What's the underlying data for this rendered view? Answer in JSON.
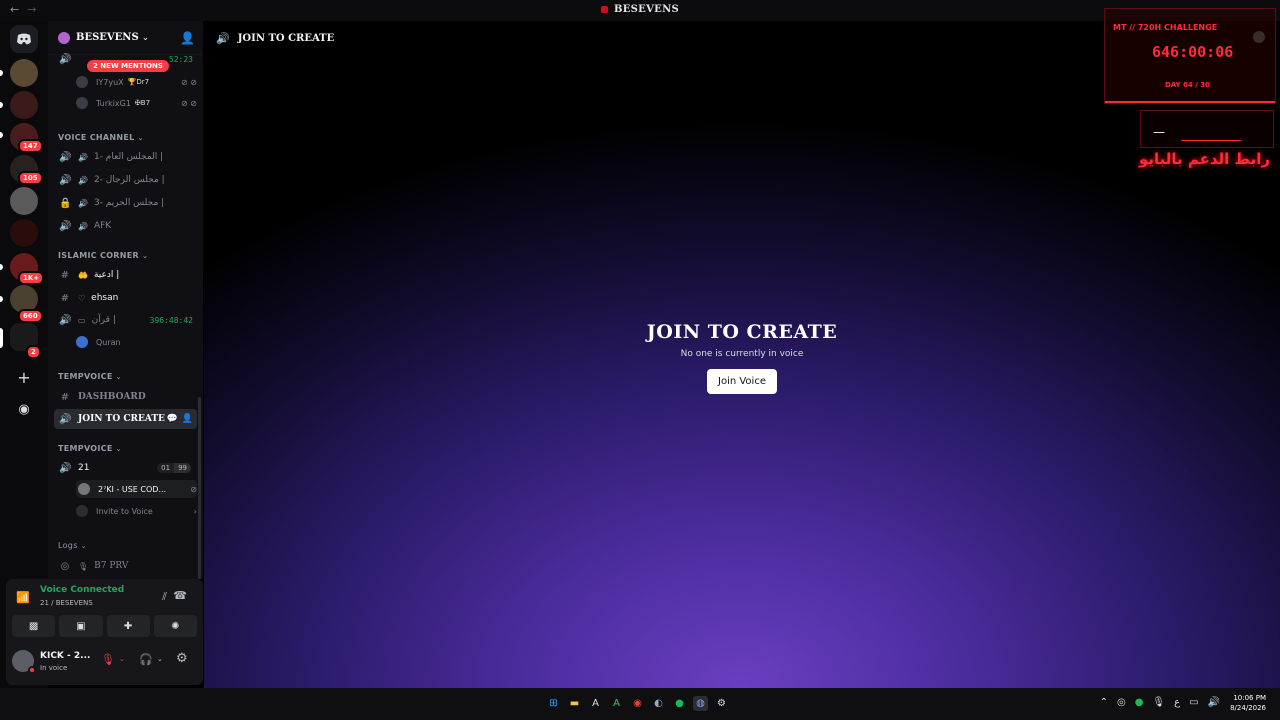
{
  "window": {
    "title": "BESEVENS"
  },
  "server": {
    "name": "BESEVENS"
  },
  "rail_badges": [
    "147",
    "105",
    "1K+",
    "660",
    "2"
  ],
  "mentions": "2 NEW MENTIONS",
  "top_users": [
    {
      "name": "IY7yuX",
      "tag": "🏆Dr7"
    },
    {
      "name": "TurkixG1",
      "tag": "✠B7"
    }
  ],
  "top_timer": "52:23",
  "categories": {
    "voice": "VOICE CHANNEL",
    "islamic": "ISLAMIC CORNER",
    "temp1": "TEMPVOICE",
    "temp2": "TEMPVOICE",
    "logs": "Logs"
  },
  "voice_channels": [
    {
      "name": "المجلس العام -1 |"
    },
    {
      "name": "مجلس الرجال -2 |"
    },
    {
      "name": "مجلس الحريم -3 |"
    },
    {
      "name": "AFK"
    }
  ],
  "islamic": {
    "ch1": "ادعية |",
    "ch2": "ehsan",
    "ch3": "قرآن |",
    "ch3_timer": "396:48:42",
    "quran_user": "Quran"
  },
  "temp": {
    "dashboard": "DASHBOARD",
    "join": "JOIN TO CREATE",
    "room": "21",
    "count_a": "01",
    "count_b": "99",
    "member": "2⁷KI - USE COD...",
    "invite": "Invite to Voice",
    "b7": "B7 PRV"
  },
  "panel": {
    "status": "Voice Connected",
    "location": "21 / BESEVENS",
    "username": "KICK - 2...",
    "state": "In voice"
  },
  "main": {
    "channel": "JOIN TO CREATE",
    "heading": "JOIN TO CREATE",
    "subtext": "No one is currently in voice",
    "button": "Join Voice"
  },
  "overlay": {
    "challenge": "MT // 720H CHALLENGE",
    "timer": "646:00:06",
    "day": "DAY 04 / 30",
    "arabic": "رابط الدعم بالبايو"
  },
  "clock": {
    "time": "10:06 PM",
    "date": "8/24/2026"
  },
  "tray_lang": "ع",
  "colors": {
    "green": "#23a55a",
    "red": "#f23f43",
    "accent_red": "#ff2a3a",
    "bg": "#101014"
  }
}
